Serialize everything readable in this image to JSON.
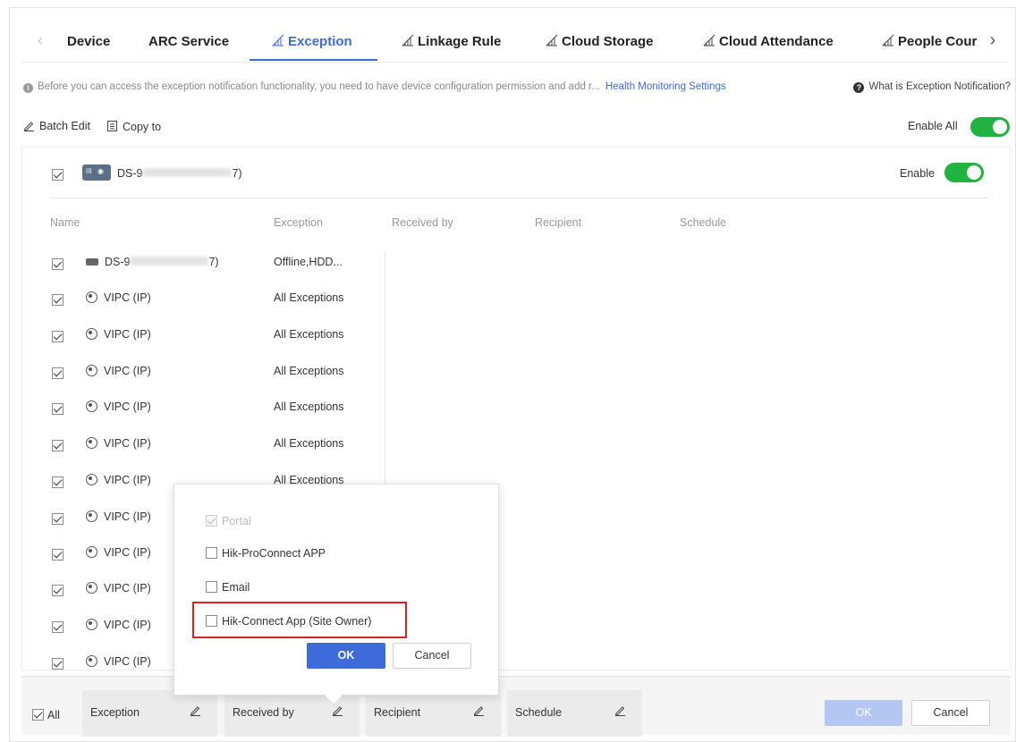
{
  "tabs": {
    "items": [
      "Device",
      "ARC Service",
      "Exception",
      "Linkage Rule",
      "Cloud Storage",
      "Cloud Attendance",
      "People Cour"
    ],
    "active": "Exception"
  },
  "info": {
    "message": "Before you can access the exception notification functionality, you need to have device configuration permission and add r...",
    "link": "Health Monitoring Settings",
    "help": "What is Exception Notification?"
  },
  "toolbar": {
    "batch_edit": "Batch Edit",
    "copy_to": "Copy to",
    "enable_all": "Enable All"
  },
  "device": {
    "name_prefix": "DS-9",
    "name_suffix": "7)",
    "enable_label": "Enable"
  },
  "columns": {
    "name": "Name",
    "exception": "Exception",
    "received_by": "Received by",
    "recipient": "Recipient",
    "schedule": "Schedule"
  },
  "rows": [
    {
      "name_prefix": "DS-9",
      "name_suffix": "7)",
      "exception": "Offline,HDD..."
    },
    {
      "name": "VIPC (IP)",
      "exception": "All Exceptions"
    },
    {
      "name": "VIPC (IP)",
      "exception": "All Exceptions"
    },
    {
      "name": "VIPC (IP)",
      "exception": "All Exceptions"
    },
    {
      "name": "VIPC (IP)",
      "exception": "All Exceptions"
    },
    {
      "name": "VIPC (IP)",
      "exception": "All Exceptions"
    },
    {
      "name": "VIPC (IP)",
      "exception": "All Exceptions"
    },
    {
      "name": "VIPC (IP)",
      "exception": ""
    },
    {
      "name": "VIPC (IP)",
      "exception": ""
    },
    {
      "name": "VIPC (IP)",
      "exception": ""
    },
    {
      "name": "VIPC (IP)",
      "exception": ""
    },
    {
      "name": "VIPC (IP)",
      "exception": ""
    }
  ],
  "popup": {
    "options": [
      "Portal",
      "Hik-ProConnect APP",
      "Email",
      "Hik-Connect App (Site Owner)"
    ],
    "ok": "OK",
    "cancel": "Cancel"
  },
  "bottom": {
    "all": "All",
    "fields": [
      "Exception",
      "Received by",
      "Recipient",
      "Schedule"
    ],
    "ok": "OK",
    "cancel": "Cancel"
  },
  "colors": {
    "accent": "#3d6bdc",
    "toggle_on": "#21b33f",
    "highlight": "#e0201f"
  }
}
